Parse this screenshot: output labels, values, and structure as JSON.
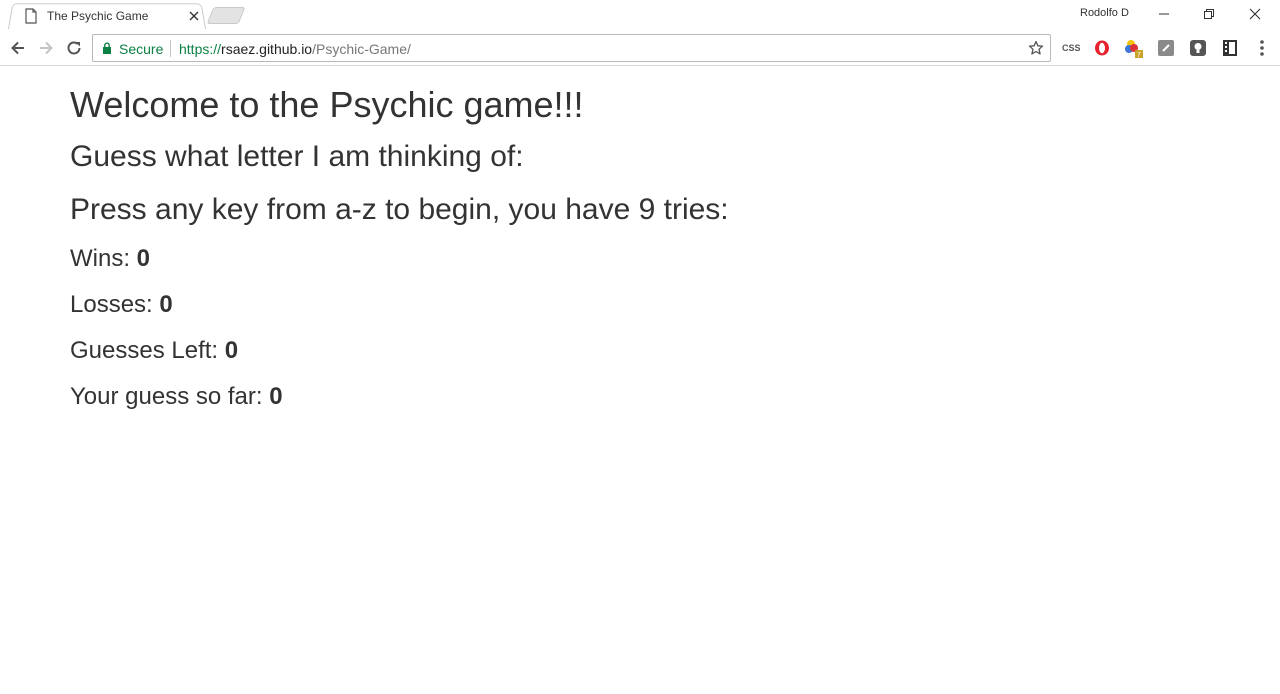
{
  "browser": {
    "tab_title": "The Psychic Game",
    "profile_name": "Rodolfo D",
    "secure_label": "Secure",
    "url": {
      "scheme": "https://",
      "host": "rsaez.github.io",
      "path": "/Psychic-Game/"
    },
    "extensions": [
      "css-icon",
      "opera-icon",
      "color-picker-icon",
      "gray-square-icon",
      "lightbulb-icon",
      "film-icon"
    ],
    "extension_css_text": "CSS",
    "extension_badge": "7"
  },
  "colors": {
    "secure_green": "#0b8043",
    "text": "#333333",
    "opera_red": "#e8222d"
  },
  "page": {
    "title": "Welcome to the Psychic game!!!",
    "prompt": "Guess what letter I am thinking of:",
    "instruction": "Press any key from a-z to begin, you have 9 tries:",
    "stats": {
      "wins_label": "Wins:",
      "wins_value": "0",
      "losses_label": "Losses:",
      "losses_value": "0",
      "guesses_left_label": "Guesses Left:",
      "guesses_left_value": "0",
      "guess_so_far_label": "Your guess so far:",
      "guess_so_far_value": "0"
    }
  }
}
